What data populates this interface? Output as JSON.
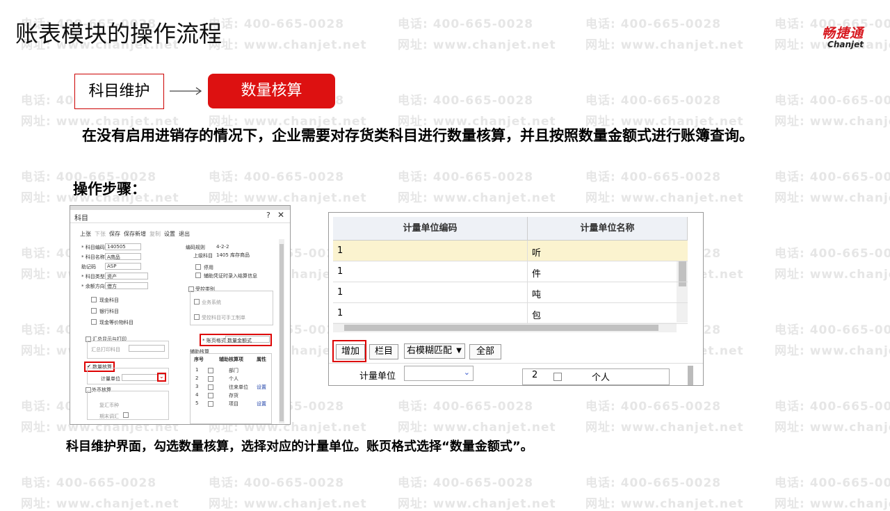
{
  "slide": {
    "title": "账表模块的操作流程",
    "logo_cn": "畅捷通",
    "logo_en": "Chanjet",
    "watermark_phone": "电话: 400-665-0028",
    "watermark_web": "网址: www.chanjet.net",
    "step1": "科目维护",
    "step2": "数量核算",
    "description": "在没有启用进销存的情况下，企业需要对存货类科目进行数量核算，并且按照数量金额式进行账簿查询。",
    "steps_heading": "操作步骤：",
    "caption": "科目维护界面，勾选数量核算，选择对应的计量单位。账页格式选择“数量金额式”。",
    "accent_color": "#d11111"
  },
  "left_window": {
    "title": "科目",
    "toolbar": [
      "上张",
      "下张",
      "保存",
      "保存新增",
      "复制",
      "设置",
      "退出"
    ],
    "fields": [
      {
        "label": "* 科目编码",
        "value": "140505"
      },
      {
        "label": "* 科目名称",
        "value": "A商品"
      },
      {
        "label": "助记码",
        "value": "ASP"
      },
      {
        "label": "* 科目类型",
        "value": "资产"
      },
      {
        "label": "* 余额方向",
        "value": "借方"
      }
    ],
    "encoding_rule_label": "编码规则",
    "encoding_rule_value": "4-2-2",
    "parent_label": "上级科目",
    "parent_value": "1405 库存商品",
    "checks_right": [
      "停用",
      "辅助凭证时录入结算信息"
    ],
    "checks_left": [
      "现金科目",
      "银行科目",
      "现金等价物科目"
    ],
    "control_group": "受控类别",
    "control_items": [
      "业务系统",
      "受控科目可手工制单"
    ],
    "summary_group": "汇总显示与打印",
    "summary_item": "汇总打印科目",
    "ledger_format_label": "* 账页格式",
    "ledger_format_value": "数量金额式",
    "qty_group": "数量核算",
    "unit_label": "计量单位",
    "fx_group": "外币核算",
    "fx_items": [
      "复汇币种",
      "期末调汇"
    ],
    "aux_group": "辅助核算",
    "aux_headers": [
      "序号",
      "",
      "辅助核算项",
      "属性"
    ],
    "aux_rows": [
      {
        "no": "1",
        "name": "部门",
        "prop": ""
      },
      {
        "no": "2",
        "name": "个人",
        "prop": ""
      },
      {
        "no": "3",
        "name": "往来单位",
        "prop": "设置"
      },
      {
        "no": "4",
        "name": "存货",
        "prop": ""
      },
      {
        "no": "5",
        "name": "项目",
        "prop": "设置"
      }
    ]
  },
  "unit_popup": {
    "headers": [
      "计量单位编码",
      "计量单位名称"
    ],
    "rows": [
      {
        "code": "1",
        "name": "听"
      },
      {
        "code": "1",
        "name": "件"
      },
      {
        "code": "1",
        "name": "吨"
      },
      {
        "code": "1",
        "name": "包"
      }
    ],
    "add_button": "增加",
    "columns_button": "栏目",
    "match_select": "右模糊匹配",
    "all_button": "全部",
    "behind_label": "计量单位",
    "behind_row_no": "2",
    "behind_row_name": "个人"
  }
}
